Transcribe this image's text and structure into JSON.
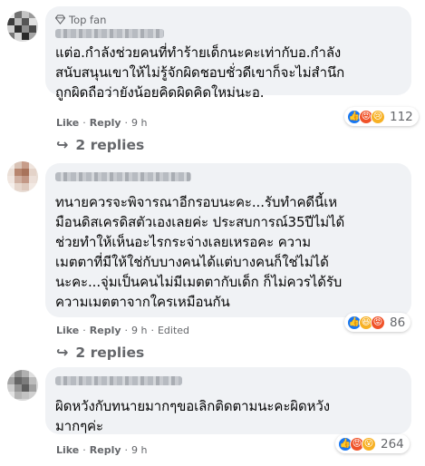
{
  "comments": [
    {
      "badge": "Top fan",
      "text": "แต่อ.กำลังช่วยคนที่ทำร้ายเด็กนะคะเท่ากับอ.กำลัง\nสนับสนุนเขาให้ไม่รู้จักผิดชอบชั่วดีเขาก็จะไม่สำนึก\nถูกผิดถือว่ายังน้อยคิดผิดคิดใหม่นะอ.",
      "like": "Like",
      "reply": "Reply",
      "time": "9 h",
      "edited": "",
      "reaction_count": "112",
      "reactions": [
        "like",
        "angry",
        "sad"
      ],
      "replies": "2 replies"
    },
    {
      "badge": "",
      "text": "ทนายควรจะพิจารณาอีกรอบนะคะ...รับทำคดีนี้เห\nมือนดิสเครดิสตัวเองเลยค่ะ ประสบการณ์35ปีไม่ได้\nช่วยทำให้เห็นอะไรกระจ่างเลยเหรอคะ ความ\nเมตตาที่มีให้ใช่กับบางคนได้แต่บางคนก็ใช่ไม่ได้\nนะคะ...จุ่มเป็นคนไม่มีเมตตากับเด็ก ก็ไม่ควรได้รับ\nความเมตตาจากใครเหมือนกัน",
      "like": "Like",
      "reply": "Reply",
      "time": "9 h",
      "edited": "Edited",
      "reaction_count": "86",
      "reactions": [
        "like",
        "haha",
        "angry"
      ],
      "replies": "2 replies"
    },
    {
      "badge": "",
      "text": "ผิดหวังกับทนายมากๆขอเลิกติดตามนะคะผิดหวัง\nมากๆค่ะ",
      "like": "Like",
      "reply": "Reply",
      "time": "9 h",
      "edited": "",
      "reaction_count": "264",
      "reactions": [
        "like",
        "angry",
        "wow"
      ],
      "replies": ""
    }
  ],
  "colors": {
    "like": "#1877f2",
    "angry": "#f0532a",
    "sad": "#f7b125",
    "haha": "#f7b125",
    "wow": "#f7b125",
    "meta": "#65676b",
    "bubble": "#f0f2f5"
  },
  "icons": {
    "badge": "diamond-icon",
    "replies": "reply-arrow-icon"
  }
}
